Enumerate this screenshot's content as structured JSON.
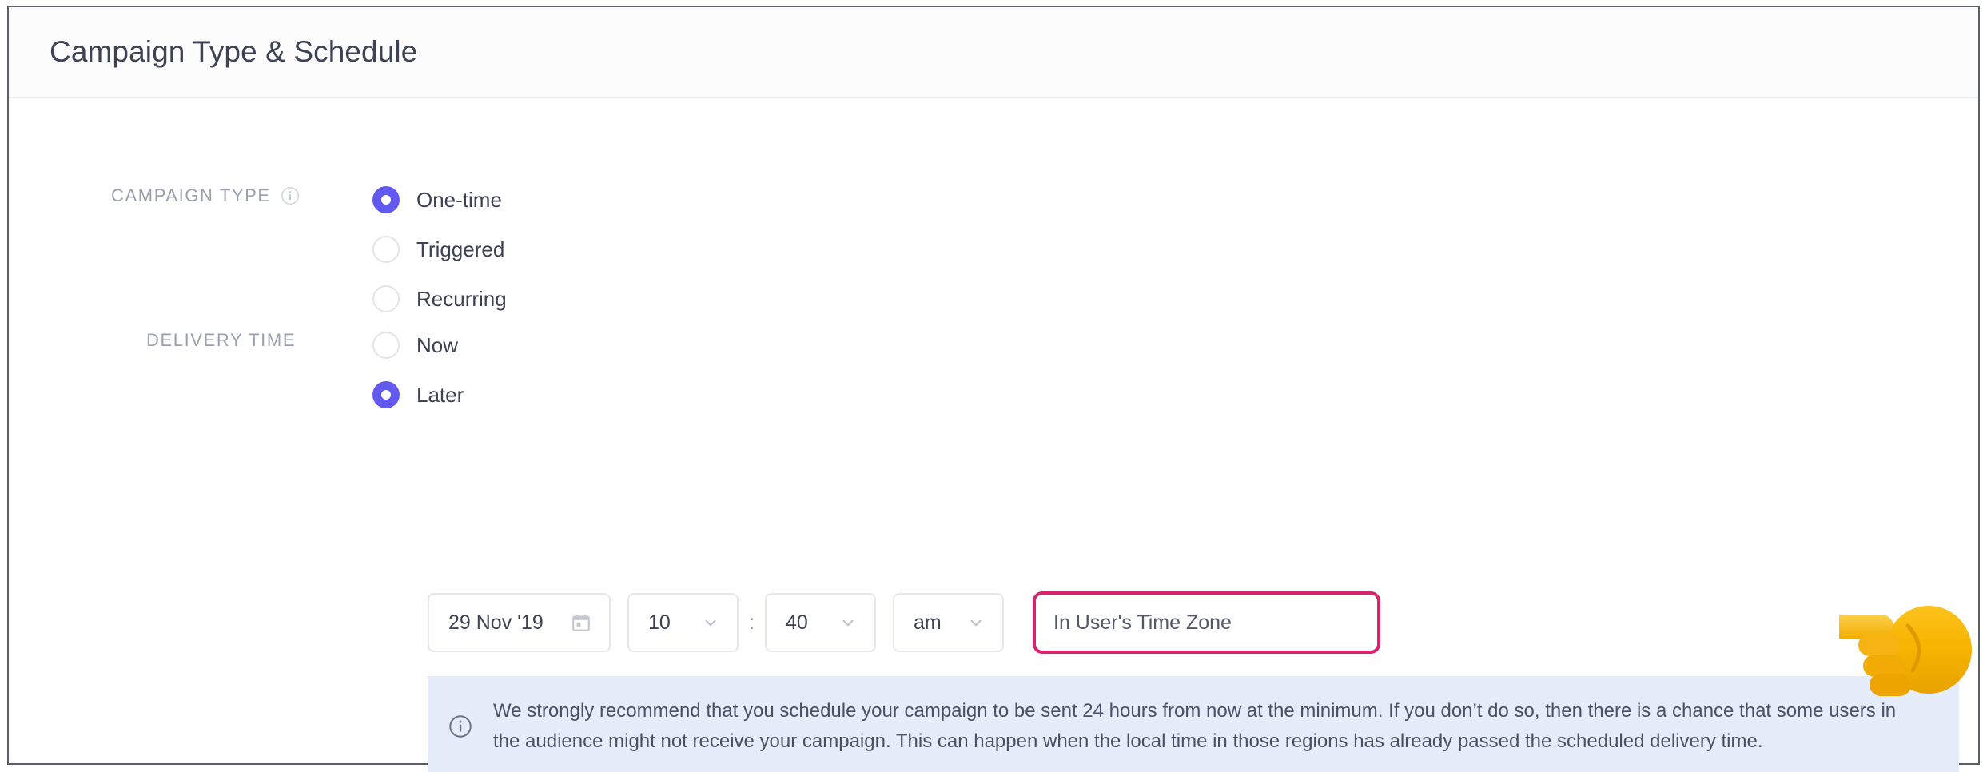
{
  "header": {
    "title": "Campaign Type & Schedule"
  },
  "campaign_type": {
    "label": "CAMPAIGN TYPE",
    "info_icon": "info-circle-icon",
    "options": [
      {
        "label": "One-time",
        "selected": true
      },
      {
        "label": "Triggered",
        "selected": false
      },
      {
        "label": "Recurring",
        "selected": false
      }
    ]
  },
  "delivery_time": {
    "label": "DELIVERY TIME",
    "options": [
      {
        "label": "Now",
        "selected": false
      },
      {
        "label": "Later",
        "selected": true
      }
    ]
  },
  "schedule": {
    "date": {
      "value": "29 Nov '19",
      "icon": "calendar-icon"
    },
    "hour": {
      "value": "10",
      "icon": "chevron-down-icon"
    },
    "separator": ":",
    "minute": {
      "value": "40",
      "icon": "chevron-down-icon"
    },
    "meridiem": {
      "value": "am",
      "icon": "chevron-down-icon"
    },
    "timezone": {
      "value": "In User's Time Zone",
      "highlighted": true,
      "highlight_color": "#d6246e"
    }
  },
  "banner": {
    "icon": "info-circle-icon",
    "text": "We strongly recommend that you schedule your campaign to be sent 24 hours from now at the minimum. If you don’t do so, then there is a chance that some users in the audience might not receive your campaign. This can happen when the local time in those regions has already passed the scheduled delivery time.",
    "background_color": "#e4edf9"
  },
  "annotation": {
    "pointer_icon": "pointing-left-hand-emoji"
  },
  "colors": {
    "accent": "#6159f0",
    "highlight": "#d6246e",
    "text": "#3d4355",
    "muted_text": "#9ba0ad",
    "banner_bg": "#e4edf9"
  }
}
